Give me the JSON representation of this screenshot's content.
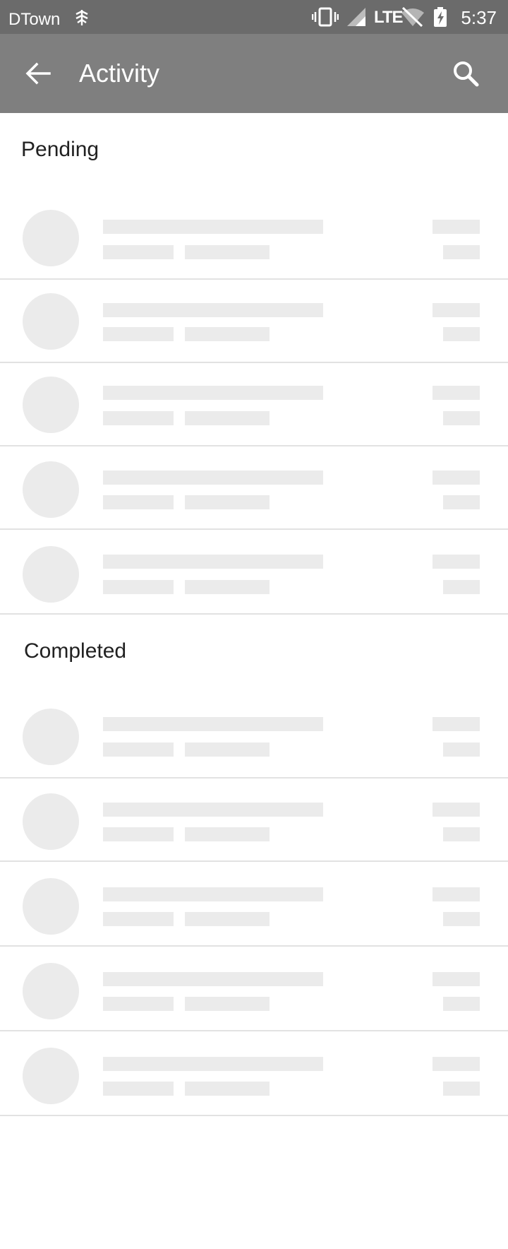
{
  "status_bar": {
    "carrier": "DTown",
    "network": "LTE",
    "time": "5:37",
    "icons": [
      "signal-broadcast-icon",
      "vibrate-icon",
      "cell-signal-icon",
      "lte-icon",
      "wifi-off-icon",
      "battery-charging-icon"
    ]
  },
  "app_bar": {
    "title": "Activity",
    "back_icon": "arrow-back-icon",
    "search_icon": "search-icon",
    "background": "#7f7f7f"
  },
  "sections": {
    "pending": {
      "label": "Pending",
      "loading_rows": 5
    },
    "completed": {
      "label": "Completed",
      "loading_rows": 5
    }
  },
  "colors": {
    "status_bar": "#6b6b6b",
    "placeholder": "#ebebeb",
    "divider": "#e2e2e2"
  }
}
